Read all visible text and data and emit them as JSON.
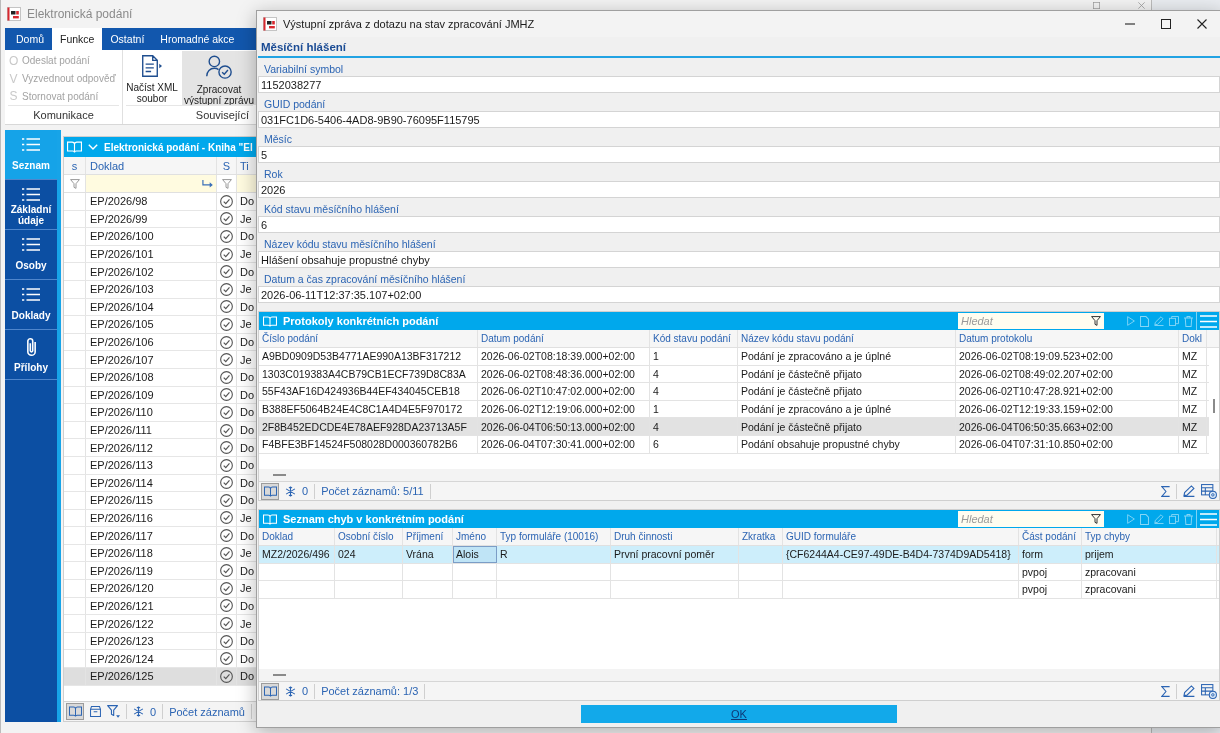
{
  "app_window": {
    "title": "Elektronická podání"
  },
  "ribbon": {
    "tabs": [
      {
        "label": "Domů",
        "selected": false
      },
      {
        "label": "Funkce",
        "selected": true
      },
      {
        "label": "Ostatní",
        "selected": false
      },
      {
        "label": "Hromadné akce",
        "selected": false
      }
    ],
    "groups": [
      {
        "label": "Komunikace",
        "kind": "small",
        "items": [
          {
            "key": "O",
            "label": "Odeslat podání",
            "disabled": true
          },
          {
            "key": "V",
            "label": "Vyzvednout odpověď",
            "disabled": true
          },
          {
            "key": "S",
            "label": "Stornovat podání",
            "disabled": true
          }
        ]
      },
      {
        "label": "Související",
        "kind": "large",
        "items": [
          {
            "label": "Načíst XML soubor",
            "pressed": false
          },
          {
            "label": "Zpracovat výstupní zprávu",
            "pressed": true
          }
        ]
      }
    ]
  },
  "sidebar": {
    "items": [
      {
        "label": "Seznam",
        "kind": "list",
        "selected": true
      },
      {
        "label": "Základní údaje",
        "kind": "list",
        "selected": false
      },
      {
        "label": "Osoby",
        "kind": "list",
        "selected": false
      },
      {
        "label": "Doklady",
        "kind": "list",
        "selected": false
      },
      {
        "label": "Přílohy",
        "kind": "attachments",
        "selected": false
      }
    ]
  },
  "doc_list": {
    "title": "Elektronická podání - Kniha \"El",
    "columns": [
      "s",
      "Doklad",
      "S",
      "Ti"
    ],
    "rows": [
      {
        "doklad": "EP/2026/98",
        "confirmed": true,
        "column_4": "Do",
        "selected": false
      },
      {
        "doklad": "EP/2026/99",
        "confirmed": true,
        "column_4": "Je",
        "selected": false
      },
      {
        "doklad": "EP/2026/100",
        "confirmed": true,
        "column_4": "Do",
        "selected": false
      },
      {
        "doklad": "EP/2026/101",
        "confirmed": true,
        "column_4": "Je",
        "selected": false
      },
      {
        "doklad": "EP/2026/102",
        "confirmed": true,
        "column_4": "Do",
        "selected": false
      },
      {
        "doklad": "EP/2026/103",
        "confirmed": true,
        "column_4": "Je",
        "selected": false
      },
      {
        "doklad": "EP/2026/104",
        "confirmed": true,
        "column_4": "Do",
        "selected": false
      },
      {
        "doklad": "EP/2026/105",
        "confirmed": true,
        "column_4": "Je",
        "selected": false
      },
      {
        "doklad": "EP/2026/106",
        "confirmed": true,
        "column_4": "Do",
        "selected": false
      },
      {
        "doklad": "EP/2026/107",
        "confirmed": true,
        "column_4": "Je",
        "selected": false
      },
      {
        "doklad": "EP/2026/108",
        "confirmed": true,
        "column_4": "Do",
        "selected": false
      },
      {
        "doklad": "EP/2026/109",
        "confirmed": true,
        "column_4": "Do",
        "selected": false
      },
      {
        "doklad": "EP/2026/110",
        "confirmed": true,
        "column_4": "Do",
        "selected": false
      },
      {
        "doklad": "EP/2026/111",
        "confirmed": true,
        "column_4": "Do",
        "selected": false
      },
      {
        "doklad": "EP/2026/112",
        "confirmed": true,
        "column_4": "Do",
        "selected": false
      },
      {
        "doklad": "EP/2026/113",
        "confirmed": true,
        "column_4": "Do",
        "selected": false
      },
      {
        "doklad": "EP/2026/114",
        "confirmed": true,
        "column_4": "Do",
        "selected": false
      },
      {
        "doklad": "EP/2026/115",
        "confirmed": true,
        "column_4": "Do",
        "selected": false
      },
      {
        "doklad": "EP/2026/116",
        "confirmed": true,
        "column_4": "Je",
        "selected": false
      },
      {
        "doklad": "EP/2026/117",
        "confirmed": true,
        "column_4": "Do",
        "selected": false
      },
      {
        "doklad": "EP/2026/118",
        "confirmed": true,
        "column_4": "Je",
        "selected": false
      },
      {
        "doklad": "EP/2026/119",
        "confirmed": true,
        "column_4": "Do",
        "selected": false
      },
      {
        "doklad": "EP/2026/120",
        "confirmed": true,
        "column_4": "Je",
        "selected": false
      },
      {
        "doklad": "EP/2026/121",
        "confirmed": true,
        "column_4": "Do",
        "selected": false
      },
      {
        "doklad": "EP/2026/122",
        "confirmed": true,
        "column_4": "Je",
        "selected": false
      },
      {
        "doklad": "EP/2026/123",
        "confirmed": true,
        "column_4": "Do",
        "selected": false
      },
      {
        "doklad": "EP/2026/124",
        "confirmed": true,
        "column_4": "Do",
        "selected": false
      },
      {
        "doklad": "EP/2026/125",
        "confirmed": true,
        "column_4": "Do",
        "selected": true
      }
    ],
    "footer": {
      "layout_toggle_on": true,
      "frozen_count": "0",
      "record_count": "Počet záznamů"
    }
  },
  "dialog": {
    "title": "Výstupní zpráva z dotazu na stav zpracování JMHZ",
    "section": "Měsíční hlášení",
    "fields": [
      {
        "label": "Variabilní symbol",
        "value": "1152038277"
      },
      {
        "label": "GUID podání",
        "value": "031FC1D6-5406-4AD8-9B90-76095F115795"
      },
      {
        "label": "Měsíc",
        "value": "5"
      },
      {
        "label": "Rok",
        "value": "2026"
      },
      {
        "label": "Kód stavu měsíčního hlášení",
        "value": "6"
      },
      {
        "label": "Název kódu stavu měsíčního hlášení",
        "value": "Hlášení obsahuje propustné chyby"
      },
      {
        "label": "Datum a čas zpracování měsíčního hlášení",
        "value": "2026-06-11T12:37:35.107+02:00"
      }
    ],
    "protocols": {
      "title": "Protokoly konkrétních podání",
      "search": {
        "placeholder": "Hledat"
      },
      "active": false,
      "columns": {
        "cislo_podani": "Číslo podání",
        "datum_podani": "Datum podání",
        "kod_stavu": "Kód stavu podání",
        "nazev_kodu": "Název kódu stavu podání",
        "datum_protokolu": "Datum protokolu",
        "column_6": "Dokl"
      },
      "rows": [
        {
          "selected": false,
          "cells": {
            "cislo_podani": "A9BD0909D53B4771AE990A13BF317212",
            "datum_podani": "2026-06-02T08:18:39.000+02:00",
            "kod_stavu": "1",
            "nazev_kodu": "Podání je zpracováno a je úplné",
            "datum_protokolu": "2026-06-02T08:19:09.523+02:00",
            "column_6": "MZ"
          }
        },
        {
          "selected": false,
          "cells": {
            "cislo_podani": "1303C019383A4CB79CB1ECF739D8C83A",
            "datum_podani": "2026-06-02T08:48:36.000+02:00",
            "kod_stavu": "4",
            "nazev_kodu": "Podání je částečně přijato",
            "datum_protokolu": "2026-06-02T08:49:02.207+02:00",
            "column_6": "MZ"
          }
        },
        {
          "selected": false,
          "cells": {
            "cislo_podani": "55F43AF16D424936B44EF434045CEB18",
            "datum_podani": "2026-06-02T10:47:02.000+02:00",
            "kod_stavu": "4",
            "nazev_kodu": "Podání je částečně přijato",
            "datum_protokolu": "2026-06-02T10:47:28.921+02:00",
            "column_6": "MZ"
          }
        },
        {
          "selected": false,
          "cells": {
            "cislo_podani": "B388EF5064B24E4C8C1A4D4E5F970172",
            "datum_podani": "2026-06-02T12:19:06.000+02:00",
            "kod_stavu": "1",
            "nazev_kodu": "Podání je zpracováno a je úplné",
            "datum_protokolu": "2026-06-02T12:19:33.159+02:00",
            "column_6": "MZ"
          }
        },
        {
          "selected": true,
          "cells": {
            "cislo_podani": "2F8B452EDCDE4E78AEF928DA23713A5F",
            "datum_podani": "2026-06-04T06:50:13.000+02:00",
            "kod_stavu": "4",
            "nazev_kodu": "Podání je částečně přijato",
            "datum_protokolu": "2026-06-04T06:50:35.663+02:00",
            "column_6": "MZ"
          }
        },
        {
          "selected": false,
          "cells": {
            "cislo_podani": "F4BFE3BF14524F508028D000360782B6",
            "datum_podani": "2026-06-04T07:30:41.000+02:00",
            "kod_stavu": "6",
            "nazev_kodu": "Podání obsahuje propustné chyby",
            "datum_protokolu": "2026-06-04T07:31:10.850+02:00",
            "column_6": "MZ"
          }
        }
      ],
      "footer": {
        "layout_toggle_on": true,
        "frozen_count": "0",
        "record_count": "Počet záznamů: 5/11"
      }
    },
    "errors": {
      "title": "Seznam chyb v konkrétním podání",
      "search": {
        "placeholder": "Hledat"
      },
      "active": true,
      "columns": {
        "doklad": "Doklad",
        "osobni_cislo": "Osobní číslo",
        "prijmeni": "Příjmení",
        "jmeno": "Jméno",
        "typ_formulare": "Typ formuláře (10016)",
        "druh_cinnosti": "Druh činnosti",
        "zkratka": "Zkratka",
        "guid_formulare": "GUID formuláře",
        "cast_podani": "Část podání",
        "typ_chyby": "Typ chyby"
      },
      "rows": [
        {
          "selected": true,
          "cells": {
            "doklad": {
              "text": "MZ2/2026/496",
              "focused": false
            },
            "osobni_cislo": {
              "text": "024",
              "focused": false
            },
            "prijmeni": {
              "text": "Vrána",
              "focused": false
            },
            "jmeno": {
              "text": "Alois",
              "focused": true
            },
            "typ_formulare": {
              "text": "R",
              "focused": false
            },
            "druh_cinnosti": {
              "text": "První pracovní poměr",
              "focused": false
            },
            "guid_formulare": {
              "text": "{CF6244A4-CE97-49DE-B4D4-7374D9AD5418}",
              "focused": false
            },
            "cast_podani": {
              "text": "form",
              "focused": false
            },
            "typ_chyby": {
              "text": "prijem",
              "focused": false
            }
          }
        },
        {
          "selected": false,
          "cells": {
            "cast_podani": {
              "text": "pvpoj",
              "focused": false
            },
            "typ_chyby": {
              "text": "zpracovani",
              "focused": false
            }
          }
        },
        {
          "selected": false,
          "cells": {
            "cast_podani": {
              "text": "pvpoj",
              "focused": false
            },
            "typ_chyby": {
              "text": "zpracovani",
              "focused": false
            }
          }
        }
      ],
      "footer": {
        "layout_toggle_on": true,
        "frozen_count": "0",
        "record_count": "Počet záznamů: 1/3"
      }
    },
    "ok_button": "OK"
  }
}
